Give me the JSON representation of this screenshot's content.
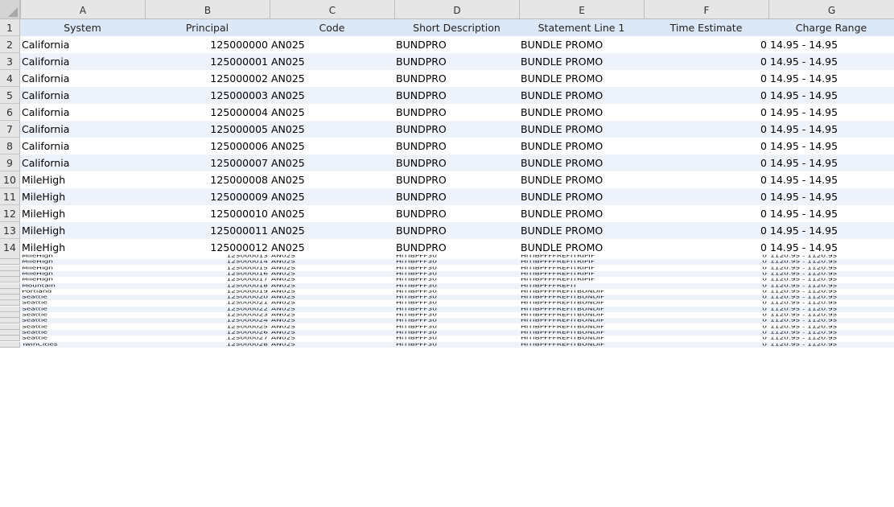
{
  "columns": [
    {
      "letter": "A",
      "header": "System"
    },
    {
      "letter": "B",
      "header": "Principal"
    },
    {
      "letter": "C",
      "header": "Code"
    },
    {
      "letter": "D",
      "header": "Short Description"
    },
    {
      "letter": "E",
      "header": "Statement Line 1"
    },
    {
      "letter": "F",
      "header": "Time Estimate"
    },
    {
      "letter": "G",
      "header": "Charge Range"
    }
  ],
  "rows": [
    {
      "num": "2",
      "system": "California",
      "principal": "125000000",
      "code": "AN025",
      "short": "BUNDPRO",
      "statement": "BUNDLE PROMO",
      "time": "0",
      "charge": "14.95 - 14.95"
    },
    {
      "num": "3",
      "system": "California",
      "principal": "125000001",
      "code": "AN025",
      "short": "BUNDPRO",
      "statement": "BUNDLE PROMO",
      "time": "0",
      "charge": "14.95 - 14.95"
    },
    {
      "num": "4",
      "system": "California",
      "principal": "125000002",
      "code": "AN025",
      "short": "BUNDPRO",
      "statement": "BUNDLE PROMO",
      "time": "0",
      "charge": "14.95 - 14.95"
    },
    {
      "num": "5",
      "system": "California",
      "principal": "125000003",
      "code": "AN025",
      "short": "BUNDPRO",
      "statement": "BUNDLE PROMO",
      "time": "0",
      "charge": "14.95 - 14.95"
    },
    {
      "num": "6",
      "system": "California",
      "principal": "125000004",
      "code": "AN025",
      "short": "BUNDPRO",
      "statement": "BUNDLE PROMO",
      "time": "0",
      "charge": "14.95 - 14.95"
    },
    {
      "num": "7",
      "system": "California",
      "principal": "125000005",
      "code": "AN025",
      "short": "BUNDPRO",
      "statement": "BUNDLE PROMO",
      "time": "0",
      "charge": "14.95 - 14.95"
    },
    {
      "num": "8",
      "system": "California",
      "principal": "125000006",
      "code": "AN025",
      "short": "BUNDPRO",
      "statement": "BUNDLE PROMO",
      "time": "0",
      "charge": "14.95 - 14.95"
    },
    {
      "num": "9",
      "system": "California",
      "principal": "125000007",
      "code": "AN025",
      "short": "BUNDPRO",
      "statement": "BUNDLE PROMO",
      "time": "0",
      "charge": "14.95 - 14.95"
    },
    {
      "num": "10",
      "system": "MileHigh",
      "principal": "125000008",
      "code": "AN025",
      "short": "BUNDPRO",
      "statement": "BUNDLE PROMO",
      "time": "0",
      "charge": "14.95 - 14.95"
    },
    {
      "num": "11",
      "system": "MileHigh",
      "principal": "125000009",
      "code": "AN025",
      "short": "BUNDPRO",
      "statement": "BUNDLE PROMO",
      "time": "0",
      "charge": "14.95 - 14.95"
    },
    {
      "num": "12",
      "system": "MileHigh",
      "principal": "125000010",
      "code": "AN025",
      "short": "BUNDPRO",
      "statement": "BUNDLE PROMO",
      "time": "0",
      "charge": "14.95 - 14.95"
    },
    {
      "num": "13",
      "system": "MileHigh",
      "principal": "125000011",
      "code": "AN025",
      "short": "BUNDPRO",
      "statement": "BUNDLE PROMO",
      "time": "0",
      "charge": "14.95 - 14.95"
    },
    {
      "num": "14",
      "system": "MileHigh",
      "principal": "125000012",
      "code": "AN025",
      "short": "BUNDPRO",
      "statement": "BUNDLE PROMO",
      "time": "0",
      "charge": "14.95 - 14.95"
    }
  ],
  "squished_rows": [
    {
      "system": "MileHigh",
      "principal": "125000013",
      "code": "AN025",
      "short": "HITIBPFF30",
      "statement": "HITIBPFFFREFITRIPIF",
      "time": "0",
      "charge": "1120.95 - 1120.95"
    },
    {
      "system": "MileHigh",
      "principal": "125000014",
      "code": "AN025",
      "short": "HITIBPFF30",
      "statement": "HITIBPFFFREFITRIPIF",
      "time": "0",
      "charge": "1120.95 - 1120.95"
    },
    {
      "system": "MileHigh",
      "principal": "125000015",
      "code": "AN025",
      "short": "HITIBPFF30",
      "statement": "HITIBPFFFREFITRIPIF",
      "time": "0",
      "charge": "1120.95 - 1120.95"
    },
    {
      "system": "MileHigh",
      "principal": "125000016",
      "code": "AN025",
      "short": "HITIBPFF30",
      "statement": "HITIBPFFFREFITRIPIF",
      "time": "0",
      "charge": "1120.95 - 1120.95"
    },
    {
      "system": "MileHigh",
      "principal": "125000017",
      "code": "AN025",
      "short": "HITIBPFF30",
      "statement": "HITIBPFFFREFITRIPIF",
      "time": "0",
      "charge": "1120.95 - 1120.95"
    },
    {
      "system": "Mountain",
      "principal": "125000018",
      "code": "AN025",
      "short": "HITIBPFF30",
      "statement": "HITIBPFFFREFIT",
      "time": "0",
      "charge": "1120.95 - 1120.95"
    },
    {
      "system": "Portland",
      "principal": "125000019",
      "code": "AN025",
      "short": "HITIBPFF30",
      "statement": "HITIBPFFFREFITBUNDIF",
      "time": "0",
      "charge": "1120.95 - 1120.95"
    },
    {
      "system": "Seattle",
      "principal": "125000020",
      "code": "AN025",
      "short": "HITIBPFF30",
      "statement": "HITIBPFFFREFITBUNDIF",
      "time": "0",
      "charge": "1120.95 - 1120.95"
    },
    {
      "system": "Seattle",
      "principal": "125000021",
      "code": "AN025",
      "short": "HITIBPFF30",
      "statement": "HITIBPFFFREFITBUNDIF",
      "time": "0",
      "charge": "1120.95 - 1120.95"
    },
    {
      "system": "Seattle",
      "principal": "125000022",
      "code": "AN025",
      "short": "HITIBPFF30",
      "statement": "HITIBPFFFREFITBUNDIF",
      "time": "0",
      "charge": "1120.95 - 1120.95"
    },
    {
      "system": "Seattle",
      "principal": "125000023",
      "code": "AN025",
      "short": "HITIBPFF30",
      "statement": "HITIBPFFFREFITBUNDIF",
      "time": "0",
      "charge": "1120.95 - 1120.95"
    },
    {
      "system": "Seattle",
      "principal": "125000024",
      "code": "AN025",
      "short": "HITIBPFF30",
      "statement": "HITIBPFFFREFITBUNDIF",
      "time": "0",
      "charge": "1120.95 - 1120.95"
    },
    {
      "system": "Seattle",
      "principal": "125000025",
      "code": "AN025",
      "short": "HITIBPFF30",
      "statement": "HITIBPFFFREFITBUNDIF",
      "time": "0",
      "charge": "1120.95 - 1120.95"
    },
    {
      "system": "Seattle",
      "principal": "125000026",
      "code": "AN025",
      "short": "HITIBPFF30",
      "statement": "HITIBPFFFREFITBUNDIF",
      "time": "0",
      "charge": "1120.95 - 1120.95"
    },
    {
      "system": "Seattle",
      "principal": "125000027",
      "code": "AN025",
      "short": "HITIBPFF30",
      "statement": "HITIBPFFFREFITBUNDIF",
      "time": "0",
      "charge": "1120.95 - 1120.95"
    },
    {
      "system": "TwinCities",
      "principal": "125000028",
      "code": "AN025",
      "short": "HITIBPFF30",
      "statement": "HITIBPFFFREFITBUNDIF",
      "time": "0",
      "charge": "1120.95 - 1120.95"
    }
  ],
  "header_row_num": "1",
  "colors": {
    "header_fill": "#dde8f7",
    "band_fill": "#eef3fb",
    "grid_head": "#e6e6e6"
  }
}
